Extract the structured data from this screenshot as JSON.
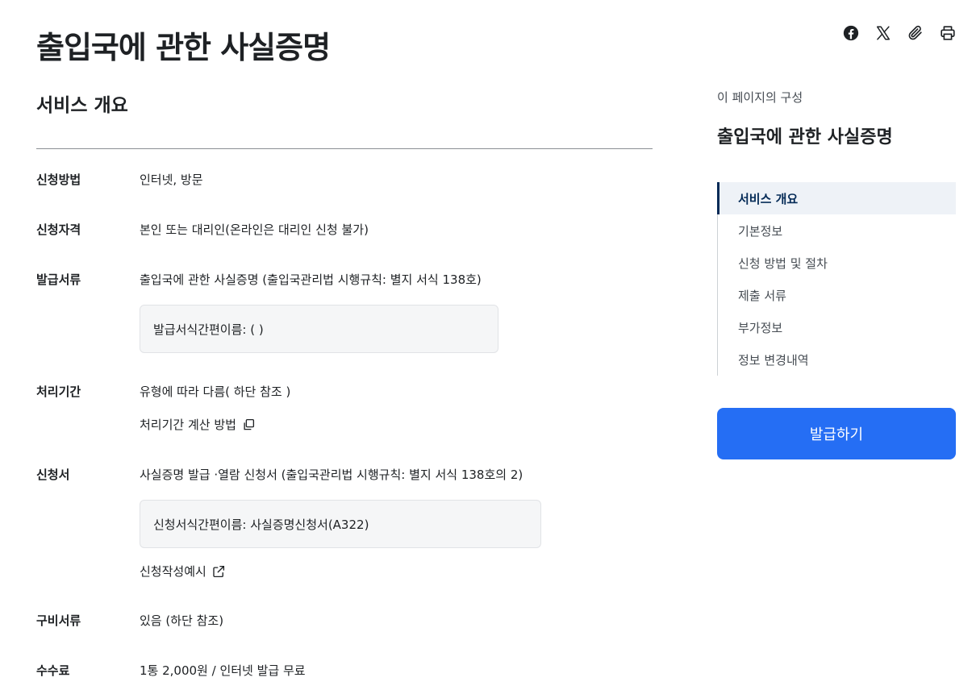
{
  "page": {
    "title": "출입국에 관한 사실증명"
  },
  "share": {
    "icons": [
      "facebook-icon",
      "x-icon",
      "paperclip-icon",
      "print-icon"
    ]
  },
  "overview": {
    "title": "서비스 개요",
    "rows": {
      "method": {
        "label": "신청방법",
        "value": "인터넷, 방문"
      },
      "eligibility": {
        "label": "신청자격",
        "value": "본인 또는 대리인(온라인은 대리인 신청 불가)"
      },
      "document": {
        "label": "발급서류",
        "value": "출입국에 관한 사실증명 (출입국관리법 시행규칙: 별지 서식 138호)",
        "box": "발급서식간편이름: ( )"
      },
      "period": {
        "label": "처리기간",
        "value": "유형에 따라 다름( 하단 참조 )",
        "link": "처리기간 계산 방법"
      },
      "form": {
        "label": "신청서",
        "value": "사실증명 발급 ·열람 신청서 (출입국관리법 시행규칙: 별지 서식 138호의 2)",
        "box": "신청서식간편이름: 사실증명신청서(A322)",
        "link": "신청작성예시"
      },
      "required": {
        "label": "구비서류",
        "value": "있음 (하단 참조)"
      },
      "fee": {
        "label": "수수료",
        "value": "1통 2,000원 / 인터넷 발급 무료"
      }
    }
  },
  "aside": {
    "caption": "이 페이지의 구성",
    "title": "출입국에 관한 사실증명",
    "toc": [
      {
        "label": "서비스 개요",
        "active": true
      },
      {
        "label": "기본정보",
        "active": false
      },
      {
        "label": "신청 방법 및 절차",
        "active": false
      },
      {
        "label": "제출 서류",
        "active": false
      },
      {
        "label": "부가정보",
        "active": false
      },
      {
        "label": "정보 변경내역",
        "active": false
      }
    ],
    "button": "발급하기"
  },
  "colors": {
    "primary": "#256ef4",
    "toc_active": "#052b57",
    "text": "#1e2124"
  }
}
